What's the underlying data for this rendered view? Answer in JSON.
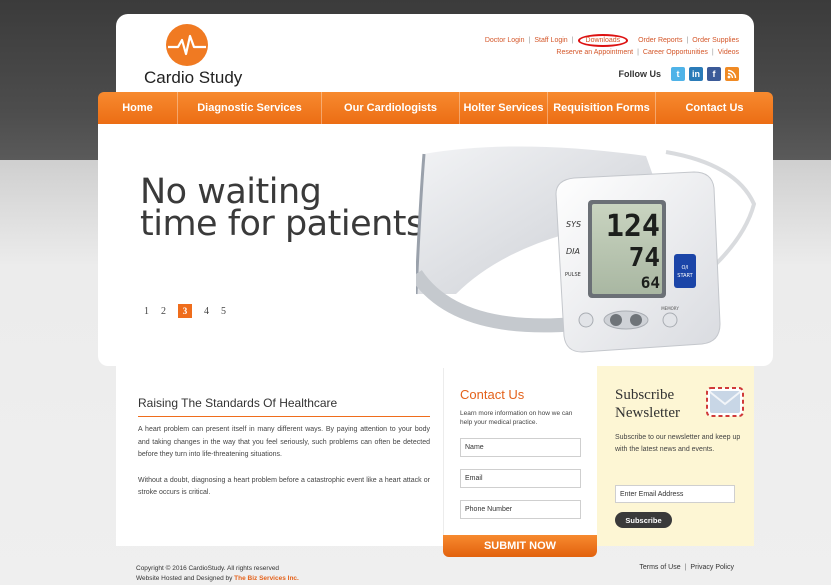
{
  "brand": {
    "name": "Cardio Study"
  },
  "top_links": {
    "row1": [
      "Doctor Login",
      "Staff Login",
      "Downloads",
      "Order Reports",
      "Order Supplies"
    ],
    "row2": [
      "Reserve an Appointment",
      "Career Opportunities",
      "Videos"
    ]
  },
  "follow": {
    "label": "Follow Us",
    "icons": [
      "twitter-icon",
      "linkedin-icon",
      "facebook-icon",
      "rss-icon"
    ]
  },
  "nav": [
    "Home",
    "Diagnostic Services",
    "Our Cardiologists",
    "Holter Services",
    "Requisition Forms",
    "Contact Us"
  ],
  "hero": {
    "line1": "No waiting",
    "line2": "time for patients",
    "pages": [
      "1",
      "2",
      "3",
      "4",
      "5"
    ],
    "active_page": "3",
    "monitor": {
      "sys": "124",
      "dia": "74",
      "pulse": "64",
      "sys_label": "SYS",
      "dia_label": "DIA",
      "pulse_label": "PULSE",
      "start_label_1": "O/I",
      "start_label_2": "START",
      "memory_label": "MEMORY"
    }
  },
  "raising": {
    "title": "Raising The Standards Of Healthcare",
    "para1": "A heart problem can present itself in many different ways. By paying attention to your body and taking changes in the way that you feel seriously, such problems can often be detected before they turn into life-threatening situations.",
    "para2": "Without a doubt, diagnosing a heart problem before a catastrophic event like a heart attack or stroke occurs is critical."
  },
  "contact": {
    "title": "Contact Us",
    "subtitle": "Learn more information on how we can help your medical practice.",
    "fields": [
      "Name",
      "Email",
      "Phone Number"
    ],
    "submit": "SUBMIT NOW"
  },
  "subscribe": {
    "title": "Subscribe Newsletter",
    "text": "Subscribe to our newsletter and keep up with the latest news and events.",
    "placeholder": "Enter Email Address",
    "button": "Subscribe"
  },
  "footer": {
    "copyright": "Copyright © 2016 CardioStudy. All rights reserved",
    "hosted_prefix": "Website Hosted and Designed by ",
    "hosted_by": "The Biz Services Inc.",
    "terms": "Terms of Use",
    "privacy": "Privacy Policy"
  },
  "colors": {
    "accent": "#ef6d1c",
    "annotation": "#d11111"
  }
}
